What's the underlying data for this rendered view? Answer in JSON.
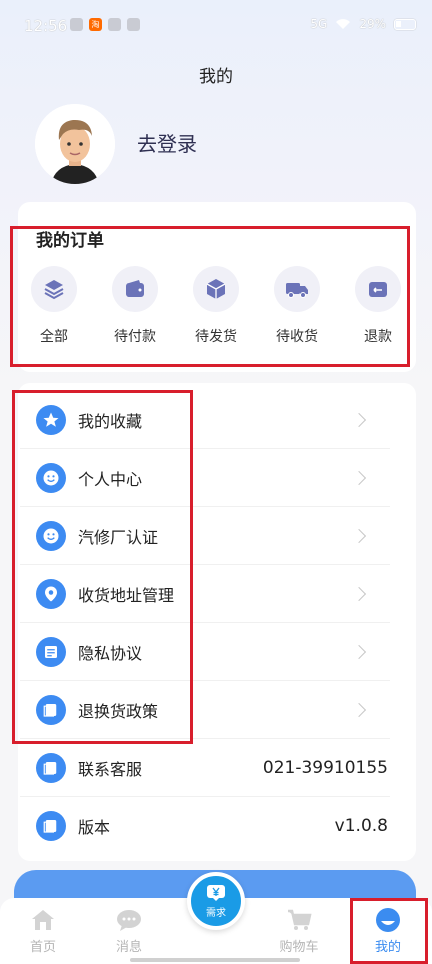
{
  "status_bar": {
    "time": "12:56",
    "taobao_badge": "淘",
    "network": "5G",
    "battery": "29%"
  },
  "header": {
    "title": "我的"
  },
  "profile": {
    "login_label": "去登录"
  },
  "orders": {
    "title": "我的订单",
    "items": [
      {
        "label": "全部",
        "icon": "layers-icon"
      },
      {
        "label": "待付款",
        "icon": "wallet-icon"
      },
      {
        "label": "待发货",
        "icon": "package-icon"
      },
      {
        "label": "待收货",
        "icon": "truck-icon"
      },
      {
        "label": "退款",
        "icon": "refund-icon"
      }
    ]
  },
  "menu": {
    "items": [
      {
        "label": "我的收藏",
        "icon": "star-icon"
      },
      {
        "label": "个人中心",
        "icon": "smile-icon"
      },
      {
        "label": "汽修厂认证",
        "icon": "smile-icon"
      },
      {
        "label": "收货地址管理",
        "icon": "location-pin-icon"
      },
      {
        "label": "隐私协议",
        "icon": "document-icon"
      },
      {
        "label": "退换货政策",
        "icon": "book-icon"
      },
      {
        "label": "联系客服",
        "icon": "book-icon",
        "value": "021-39910155"
      },
      {
        "label": "版本",
        "icon": "book-icon",
        "value": "v1.0.8"
      }
    ]
  },
  "tabbar": {
    "items": [
      {
        "label": "首页",
        "icon": "home-icon"
      },
      {
        "label": "消息",
        "icon": "chat-icon"
      },
      {
        "label": "需求",
        "icon": "yen-icon"
      },
      {
        "label": "购物车",
        "icon": "cart-icon"
      },
      {
        "label": "我的",
        "icon": "profile-icon",
        "active": true
      }
    ]
  },
  "colors": {
    "accent": "#3b8cf0",
    "menu_icon_bg": "#3d8bf2",
    "annotation": "#d81e2c"
  }
}
